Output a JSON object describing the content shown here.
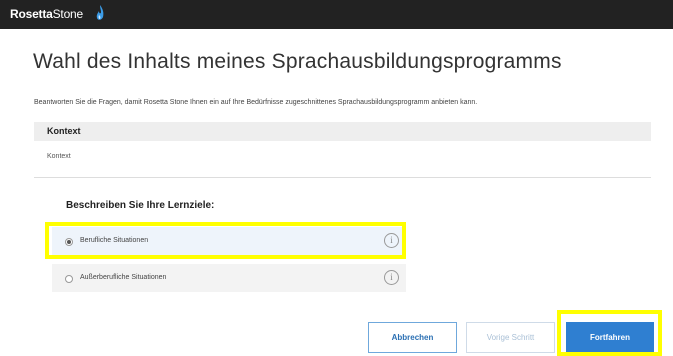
{
  "header": {
    "logo_bold": "Rosetta",
    "logo_thin": "Stone",
    "logo_icon": "flame-icon",
    "background": "#222222"
  },
  "main": {
    "title": "Wahl des Inhalts meines Sprachausbildungsprogramms",
    "intro": "Beantworten Sie die Fragen, damit Rosetta Stone Ihnen ein auf Ihre Bedürfnisse zugeschnittenes Sprachausbildungsprogramm anbieten kann.",
    "context": {
      "heading": "Kontext",
      "value": "Kontext"
    },
    "goals": {
      "heading": "Beschreiben Sie Ihre Lernziele:",
      "options": [
        {
          "label": "Berufliche Situationen",
          "selected": true,
          "info_icon": "info-icon"
        },
        {
          "label": "Außerberufliche Situationen",
          "selected": false,
          "info_icon": "info-icon"
        }
      ]
    }
  },
  "footer": {
    "cancel_label": "Abbrechen",
    "prev_label": "Vorige Schritt",
    "next_label": "Fortfahren"
  },
  "colors": {
    "accent": "#2f7fd1",
    "highlight": "#ffff00"
  }
}
